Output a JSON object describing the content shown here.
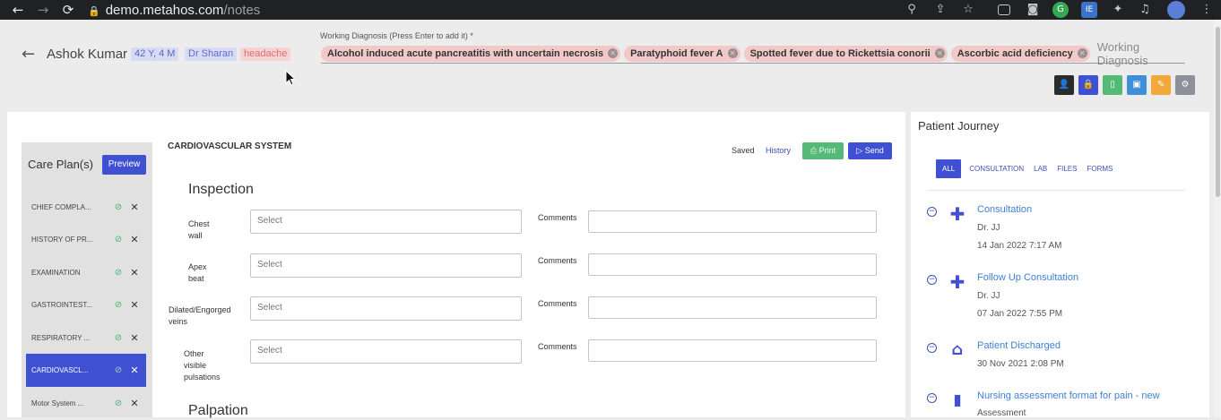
{
  "browser": {
    "back_icon": "arrow-left-icon",
    "host": "demo.metahos.com",
    "path": "/notes"
  },
  "header": {
    "patient_name": "Ashok Kumar",
    "age": "42 Y, 4 M",
    "doctor": "Dr Sharan",
    "symptom": "headache",
    "working_diagnosis_label": "Working Diagnosis (Press Enter to add it)  *",
    "diagnoses": [
      "Alcohol induced acute pancreatitis with uncertain necrosis",
      "Paratyphoid fever A",
      "Spotted fever due to Rickettsia conorii",
      "Ascorbic acid deficiency"
    ],
    "diagnosis_placeholder": "Working Diagnosis"
  },
  "toolbar": {
    "colors": [
      "#2b2b2b",
      "#3f51d2",
      "#55b978",
      "#3f8fd8",
      "#f2a93b",
      "#8d8f99"
    ]
  },
  "care_plan": {
    "title": "Care Plan(s)",
    "preview_label": "Preview",
    "items": [
      {
        "label": "CHIEF COMPLA..."
      },
      {
        "label": "HISTORY OF PR..."
      },
      {
        "label": "EXAMINATION"
      },
      {
        "label": "GASTROINTEST..."
      },
      {
        "label": "RESPIRATORY ..."
      },
      {
        "label": "CARDIOVASCL..."
      },
      {
        "label": "Motor System ..."
      }
    ],
    "active_index": 5
  },
  "form": {
    "system_title": "CARDIOVASCULAR SYSTEM",
    "saved_label": "Saved",
    "history_label": "History",
    "print_label": "Print",
    "send_label": "Send",
    "inspection_title": "Inspection",
    "palpation_title": "Palpation",
    "select_placeholder": "Select",
    "comments_label": "Comments",
    "fields": [
      {
        "label_lines": [
          "Chest",
          "wall"
        ]
      },
      {
        "label_lines": [
          "Apex",
          "beat"
        ]
      },
      {
        "label_lines": [
          "Dilated/Engorged",
          "veins"
        ]
      },
      {
        "label_lines": [
          "Other",
          "visible",
          "pulsations"
        ]
      }
    ]
  },
  "journey": {
    "title": "Patient Journey",
    "tabs": [
      "ALL",
      "CONSULTATION",
      "LAB",
      "FILES",
      "FORMS"
    ],
    "entries": [
      {
        "icon": "plus-icon",
        "name": "Consultation",
        "by": "Dr. JJ",
        "date": "14 Jan 2022 7:17 AM"
      },
      {
        "icon": "plus-icon",
        "name": "Follow Up Consultation",
        "by": "Dr. JJ",
        "date": "07 Jan 2022 7:55 PM"
      },
      {
        "icon": "home-icon",
        "name": "Patient Discharged",
        "by": "",
        "date": "30 Nov 2021 2:08 PM"
      },
      {
        "icon": "document-icon",
        "name": "Nursing assessment format for pain - new",
        "by": "Assessment",
        "date": ""
      }
    ]
  }
}
